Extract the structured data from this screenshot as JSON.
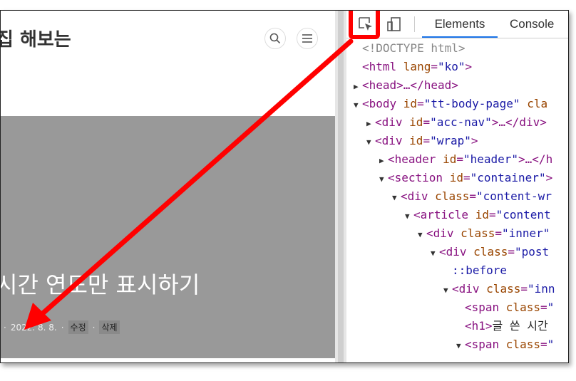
{
  "page": {
    "site_title": "집 해보는",
    "post_title": "시간 연도만 표시하기",
    "meta": {
      "dot1": "·",
      "date": "2022. 8. 8.",
      "dot2": "·",
      "edit": "수정",
      "dot3": "·",
      "delete": "삭제"
    },
    "hero_color": "#999999"
  },
  "devtools": {
    "tabs": [
      {
        "label": "Elements",
        "active": true
      },
      {
        "label": "Console",
        "active": false
      }
    ],
    "highlight_color": "#ff0000",
    "tree": [
      {
        "indent": 0,
        "toggle": "",
        "parts": [
          {
            "t": "cmt",
            "v": "<!DOCTYPE html>"
          }
        ]
      },
      {
        "indent": 0,
        "toggle": "",
        "parts": [
          {
            "t": "tag",
            "v": "<html "
          },
          {
            "t": "attr",
            "v": "lang"
          },
          {
            "t": "tag",
            "v": "="
          },
          {
            "t": "val",
            "v": "\"ko\""
          },
          {
            "t": "tag",
            "v": ">"
          }
        ]
      },
      {
        "indent": 0,
        "toggle": "▶",
        "parts": [
          {
            "t": "tag",
            "v": "<head>…</head>"
          }
        ]
      },
      {
        "indent": 0,
        "toggle": "▼",
        "parts": [
          {
            "t": "tag",
            "v": "<body "
          },
          {
            "t": "attr",
            "v": "id"
          },
          {
            "t": "tag",
            "v": "="
          },
          {
            "t": "val",
            "v": "\"tt-body-page\""
          },
          {
            "t": "attr",
            "v": " cla"
          }
        ]
      },
      {
        "indent": 1,
        "toggle": "▶",
        "parts": [
          {
            "t": "tag",
            "v": "<div "
          },
          {
            "t": "attr",
            "v": "id"
          },
          {
            "t": "tag",
            "v": "="
          },
          {
            "t": "val",
            "v": "\"acc-nav\""
          },
          {
            "t": "tag",
            "v": ">…</div>"
          }
        ]
      },
      {
        "indent": 1,
        "toggle": "▼",
        "parts": [
          {
            "t": "tag",
            "v": "<div "
          },
          {
            "t": "attr",
            "v": "id"
          },
          {
            "t": "tag",
            "v": "="
          },
          {
            "t": "val",
            "v": "\"wrap\""
          },
          {
            "t": "tag",
            "v": ">"
          }
        ]
      },
      {
        "indent": 2,
        "toggle": "▶",
        "parts": [
          {
            "t": "tag",
            "v": "<header "
          },
          {
            "t": "attr",
            "v": "id"
          },
          {
            "t": "tag",
            "v": "="
          },
          {
            "t": "val",
            "v": "\"header\""
          },
          {
            "t": "tag",
            "v": ">…</h"
          }
        ]
      },
      {
        "indent": 2,
        "toggle": "▼",
        "parts": [
          {
            "t": "tag",
            "v": "<section "
          },
          {
            "t": "attr",
            "v": "id"
          },
          {
            "t": "tag",
            "v": "="
          },
          {
            "t": "val",
            "v": "\"container\""
          },
          {
            "t": "tag",
            "v": ">"
          }
        ]
      },
      {
        "indent": 3,
        "toggle": "▼",
        "parts": [
          {
            "t": "tag",
            "v": "<div "
          },
          {
            "t": "attr",
            "v": "class"
          },
          {
            "t": "tag",
            "v": "="
          },
          {
            "t": "val",
            "v": "\"content-wr"
          }
        ]
      },
      {
        "indent": 4,
        "toggle": "▼",
        "parts": [
          {
            "t": "tag",
            "v": "<article "
          },
          {
            "t": "attr",
            "v": "id"
          },
          {
            "t": "tag",
            "v": "="
          },
          {
            "t": "val",
            "v": "\"content"
          }
        ]
      },
      {
        "indent": 5,
        "toggle": "▼",
        "parts": [
          {
            "t": "tag",
            "v": "<div "
          },
          {
            "t": "attr",
            "v": "class"
          },
          {
            "t": "tag",
            "v": "="
          },
          {
            "t": "val",
            "v": "\"inner\""
          }
        ]
      },
      {
        "indent": 6,
        "toggle": "▼",
        "parts": [
          {
            "t": "tag",
            "v": "<div "
          },
          {
            "t": "attr",
            "v": "class"
          },
          {
            "t": "tag",
            "v": "="
          },
          {
            "t": "val",
            "v": "\"post"
          }
        ]
      },
      {
        "indent": 7,
        "toggle": "",
        "parts": [
          {
            "t": "pseudo",
            "v": "::before"
          }
        ]
      },
      {
        "indent": 7,
        "toggle": "▼",
        "parts": [
          {
            "t": "tag",
            "v": "<div "
          },
          {
            "t": "attr",
            "v": "class"
          },
          {
            "t": "tag",
            "v": "="
          },
          {
            "t": "val",
            "v": "\"inn"
          }
        ]
      },
      {
        "indent": 8,
        "toggle": "",
        "parts": [
          {
            "t": "tag",
            "v": "<span "
          },
          {
            "t": "attr",
            "v": "class"
          },
          {
            "t": "tag",
            "v": "="
          },
          {
            "t": "val",
            "v": "\""
          }
        ]
      },
      {
        "indent": 8,
        "toggle": "",
        "parts": [
          {
            "t": "tag",
            "v": "<h1>"
          },
          {
            "t": "txt",
            "v": "글 쓴 시간"
          }
        ]
      },
      {
        "indent": 8,
        "toggle": "▼",
        "parts": [
          {
            "t": "tag",
            "v": "<span "
          },
          {
            "t": "attr",
            "v": "class"
          },
          {
            "t": "tag",
            "v": "="
          },
          {
            "t": "val",
            "v": "\""
          }
        ]
      }
    ]
  }
}
